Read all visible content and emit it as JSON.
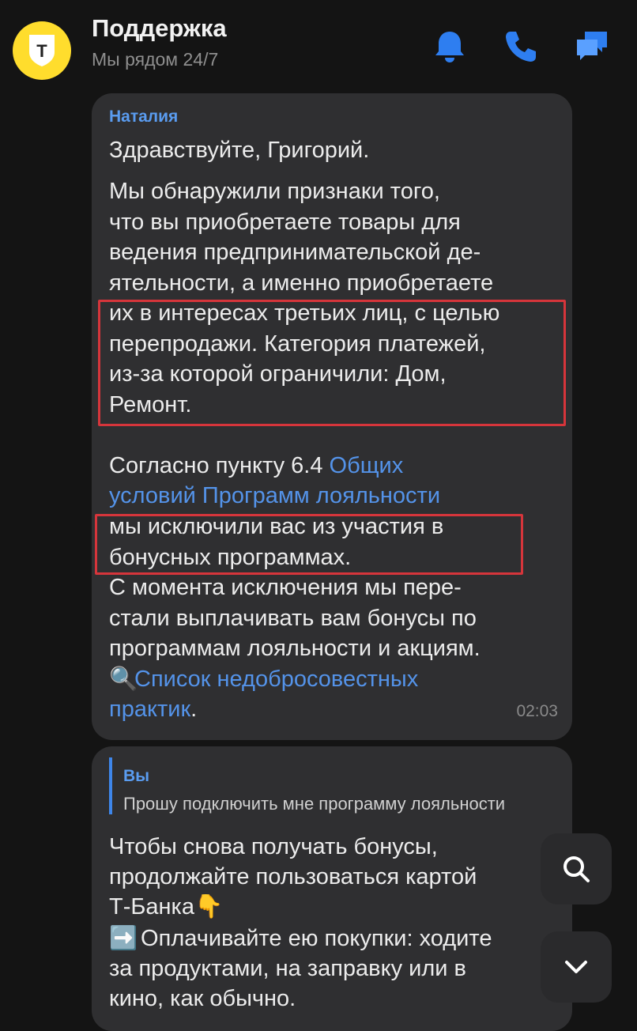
{
  "header": {
    "title": "Поддержка",
    "subtitle": "Мы рядом 24/7",
    "logo_letter": "Т",
    "icons": [
      "bell-icon",
      "phone-icon",
      "chat-icon"
    ]
  },
  "message1": {
    "sender": "Наталия",
    "greeting": "Здравствуйте, Григорий.",
    "para1": "Мы обнаружили признаки того,\nчто вы приобретаете товары для\nведения предпринимательской де-\nятельности, а именно приобретаете\nих в интересах третьих лиц, с целью\nперепродажи. Категория платежей,\nиз-за которой ограничили: Дом,\nРемонт.",
    "para2_start": "Согласно пункту 6.4 ",
    "para2_link_line1": "Общих",
    "para2_link_line2": "условий Программ лояльности",
    "para2_rest": "мы исключили вас из участия в\nбонусных программах.\nС момента исключения мы пере-\nстали выплачивать вам бонусы по\nпрограммам лояльности и акциям.",
    "magnifier_emoji": "🔍",
    "list_link_line1": "Список недобросовестных",
    "list_link_line2": "практик",
    "list_link_tail": ".",
    "time": "02:03"
  },
  "message2": {
    "reply_name": "Вы",
    "reply_text": "Прошу подключить мне программу лояльности",
    "line1": "Чтобы снова получать бонусы,",
    "line2": "продолжайте пользоваться картой",
    "line3": "Т-Банка",
    "finger_emoji": "👇",
    "arrow_emoji": "➡️",
    "line4": " Оплачивайте ею покупки: ходите",
    "line5": "за продуктами, на заправку или в",
    "line6": "кино, как обычно."
  },
  "colors": {
    "accent_link": "#5493e9",
    "bubble": "#2f2f31",
    "background": "#141414",
    "highlight_box": "#d6353b",
    "logo_yellow": "#ffdd2d"
  }
}
